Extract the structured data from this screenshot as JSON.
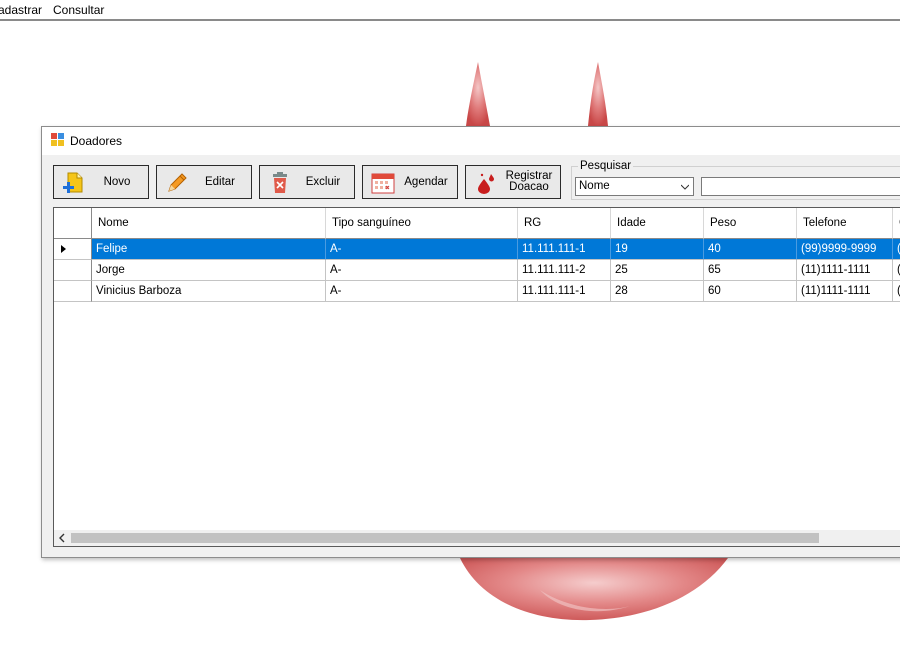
{
  "menu": {
    "items": [
      {
        "label": "adastrar"
      },
      {
        "label": "Consultar"
      }
    ]
  },
  "window": {
    "title": "Doadores"
  },
  "toolbar": {
    "buttons": [
      {
        "label": "Novo",
        "icon": "new-document-icon"
      },
      {
        "label": "Editar",
        "icon": "pencil-icon"
      },
      {
        "label": "Excluir",
        "icon": "trash-icon"
      },
      {
        "label": "Agendar",
        "icon": "calendar-icon"
      },
      {
        "label": "Registrar\nDoacao",
        "icon": "blood-drop-icon"
      }
    ]
  },
  "search": {
    "group_label": "Pesquisar",
    "field_selected": "Nome",
    "query": ""
  },
  "grid": {
    "columns": [
      "Nome",
      "Tipo sanguíneo",
      "RG",
      "Idade",
      "Peso",
      "Telefone",
      "C"
    ],
    "rows": [
      [
        "Felipe",
        "A-",
        "11.111.111-1",
        "19",
        "40",
        "(99)9999-9999",
        "(9"
      ],
      [
        "Jorge",
        "A-",
        "11.111.111-2",
        "25",
        "65",
        "(11)1111-1111",
        "(1"
      ],
      [
        "Vinicius Barboza",
        "A-",
        "11.111.111-1",
        "28",
        "60",
        "(11)1111-1111",
        "(1"
      ]
    ],
    "selected_row": 0
  },
  "colors": {
    "selection": "#0078d7",
    "drop_red": "#d9534f"
  }
}
